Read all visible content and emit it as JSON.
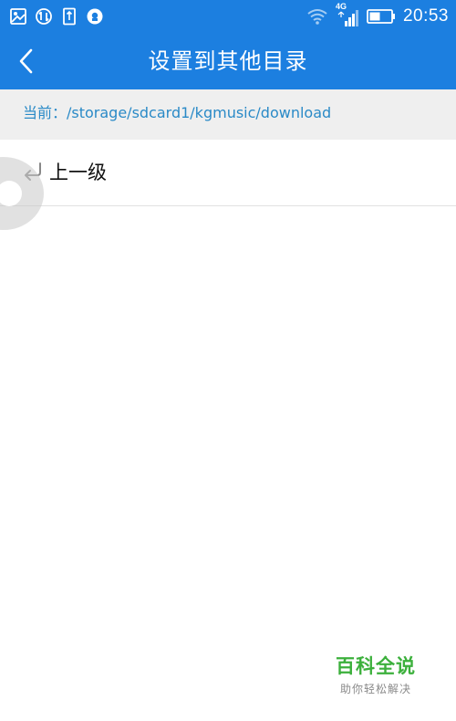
{
  "status_bar": {
    "time": "20:53",
    "network": "4G",
    "icons": [
      "gallery-icon",
      "sync-icon",
      "download-icon",
      "shield-icon",
      "wifi-icon",
      "signal-icon",
      "battery-icon"
    ]
  },
  "header": {
    "title": "设置到其他目录",
    "back_icon": "chevron-left-icon"
  },
  "path_bar": {
    "current_path": "当前：/storage/sdcard1/kgmusic/download"
  },
  "list": {
    "parent_item_label": "上一级",
    "parent_item_icon": "return-arrow-icon"
  },
  "watermark": {
    "main": "百科全说",
    "sub": "助你轻松解决"
  },
  "colors": {
    "accent": "#1c7fe0",
    "path_text": "#2a8ac7",
    "watermark": "#3cb03c"
  }
}
